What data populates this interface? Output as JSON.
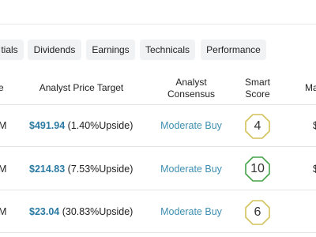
{
  "tabs": [
    {
      "label": "tials"
    },
    {
      "label": "Dividends"
    },
    {
      "label": "Earnings"
    },
    {
      "label": "Technicals"
    },
    {
      "label": "Performance"
    }
  ],
  "table": {
    "headers": {
      "left_fragment": "e",
      "price_target": "Analyst Price Target",
      "consensus_line1": "Analyst",
      "consensus_line2": "Consensus",
      "score_line1": "Smart",
      "score_line2": "Score",
      "right_fragment": "Ma"
    },
    "rows": [
      {
        "left_fragment": "M",
        "target_price": "$491.94",
        "upside": "(1.40%Upside)",
        "consensus": "Moderate Buy",
        "score": "4",
        "score_color": "#d4c25a",
        "right_fragment": "$"
      },
      {
        "left_fragment": "M",
        "target_price": "$214.83",
        "upside": "(7.53%Upside)",
        "consensus": "Moderate Buy",
        "score": "10",
        "score_color": "#46a34a",
        "right_fragment": "$"
      },
      {
        "left_fragment": "M",
        "target_price": "$23.04",
        "upside": "(30.83%Upside)",
        "consensus": "Moderate Buy",
        "score": "6",
        "score_color": "#d4c25a",
        "right_fragment": ""
      }
    ]
  }
}
